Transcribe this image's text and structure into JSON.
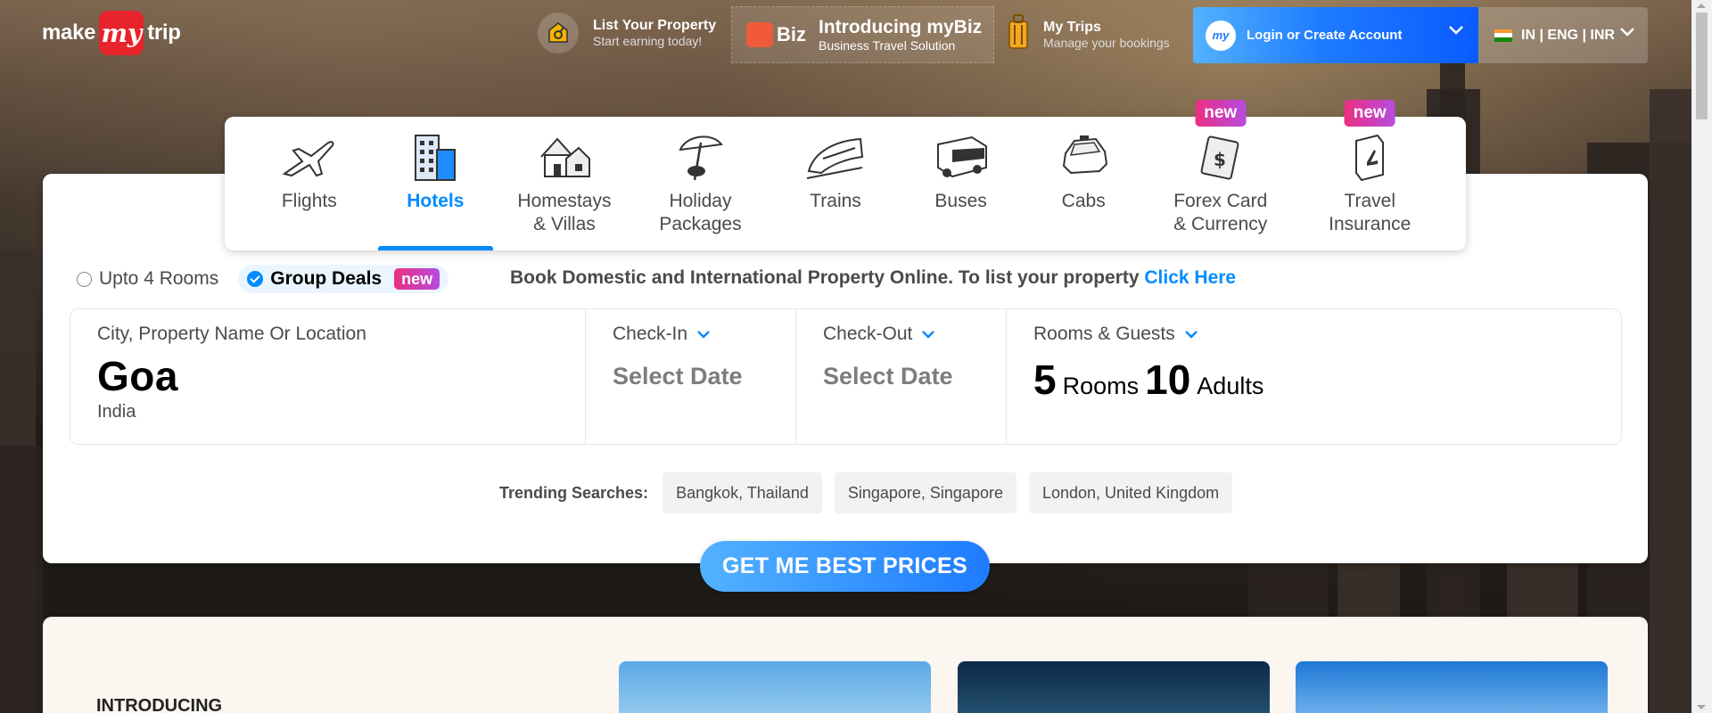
{
  "header": {
    "logo": {
      "left": "make",
      "mid": "my",
      "right": "trip"
    },
    "list_property": {
      "title": "List Your Property",
      "subtitle": "Start earning today!"
    },
    "mybiz": {
      "badge": "Biz",
      "title": "Introducing myBiz",
      "subtitle": "Business Travel Solution"
    },
    "my_trips": {
      "title": "My Trips",
      "subtitle": "Manage your bookings"
    },
    "login": {
      "label": "Login or Create Account",
      "icon_text": "my"
    },
    "locale": {
      "label": "IN | ENG | INR"
    }
  },
  "nav": {
    "items": [
      {
        "label": "Flights",
        "icon": "flight-icon",
        "active": false
      },
      {
        "label": "Hotels",
        "icon": "hotel-icon",
        "active": true
      },
      {
        "label": "Homestays\n& Villas",
        "icon": "homestay-icon",
        "active": false
      },
      {
        "label": "Holiday\nPackages",
        "icon": "holiday-icon",
        "active": false
      },
      {
        "label": "Trains",
        "icon": "train-icon",
        "active": false
      },
      {
        "label": "Buses",
        "icon": "bus-icon",
        "active": false
      },
      {
        "label": "Cabs",
        "icon": "cab-icon",
        "active": false
      },
      {
        "label": "Forex Card\n& Currency",
        "icon": "forex-icon",
        "active": false,
        "badge": "new"
      },
      {
        "label": "Travel\nInsurance",
        "icon": "insurance-icon",
        "active": false,
        "badge": "new"
      }
    ]
  },
  "booking": {
    "options": [
      {
        "label": "Upto 4 Rooms",
        "selected": false
      },
      {
        "label": "Group Deals",
        "selected": true,
        "badge": "new"
      }
    ],
    "promo_text": "Book Domestic and International Property Online. To list your property ",
    "promo_link": "Click Here"
  },
  "search": {
    "location": {
      "label": "City, Property Name Or Location",
      "value": "Goa",
      "sub": "India"
    },
    "checkin": {
      "label": "Check-In",
      "value": "Select Date"
    },
    "checkout": {
      "label": "Check-Out",
      "value": "Select Date"
    },
    "rooms_guests": {
      "label": "Rooms & Guests",
      "rooms": "5",
      "rooms_word": "Rooms",
      "adults": "10",
      "adults_word": "Adults"
    }
  },
  "trending": {
    "label": "Trending Searches:",
    "items": [
      "Bangkok, Thailand",
      "Singapore, Singapore",
      "London, United Kingdom"
    ]
  },
  "cta": {
    "label": "GET ME BEST PRICES"
  },
  "bottom": {
    "intro": "INTRODUCING"
  },
  "colors": {
    "accent": "#008cff",
    "brand_red": "#e8232b",
    "new_badge": "#ea2f81"
  }
}
